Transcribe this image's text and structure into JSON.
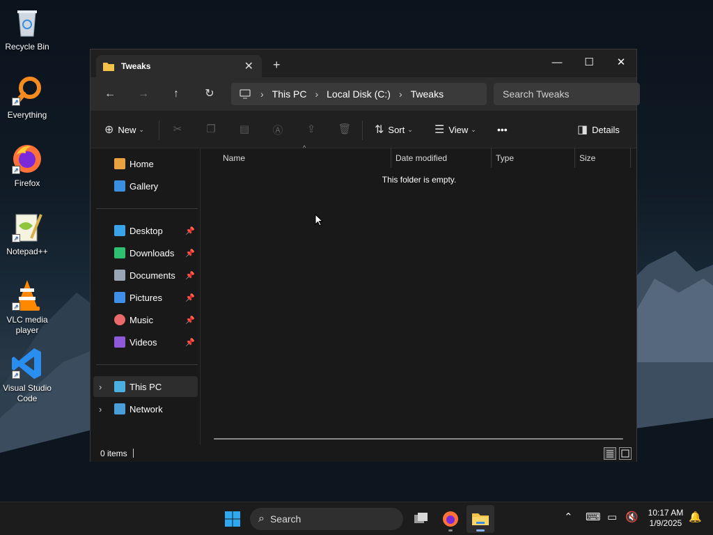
{
  "desktop": {
    "icons": [
      {
        "label": "Recycle Bin",
        "icon": "recycle-bin-icon"
      },
      {
        "label": "Everything",
        "icon": "everything-icon"
      },
      {
        "label": "Firefox",
        "icon": "firefox-icon"
      },
      {
        "label": "Notepad++",
        "icon": "notepad-plus-plus-icon"
      },
      {
        "label": "VLC media player",
        "icon": "vlc-icon"
      },
      {
        "label": "Visual Studio Code",
        "icon": "vscode-icon"
      }
    ]
  },
  "window": {
    "tab_title": "Tweaks",
    "tab_close": "✕",
    "new_tab": "+",
    "controls": {
      "minimize": "—",
      "maximize": "☐",
      "close": "✕"
    },
    "nav": {
      "back": "←",
      "forward": "→",
      "up": "↑",
      "refresh": "↻"
    },
    "breadcrumb": [
      "This PC",
      "Local Disk (C:)",
      "Tweaks"
    ],
    "search_placeholder": "Search Tweaks",
    "commands": {
      "new": "New",
      "sort": "Sort",
      "view": "View",
      "more": "•••",
      "details": "Details"
    },
    "sidebar": {
      "top": [
        {
          "label": "Home",
          "color": "#e8a040"
        },
        {
          "label": "Gallery",
          "color": "#3b8fe0"
        }
      ],
      "pinned": [
        {
          "label": "Desktop",
          "color": "#3ba3e8"
        },
        {
          "label": "Downloads",
          "color": "#2fbf71"
        },
        {
          "label": "Documents",
          "color": "#9aa6b6"
        },
        {
          "label": "Pictures",
          "color": "#3f8ee8"
        },
        {
          "label": "Music",
          "color": "#e86a6a"
        },
        {
          "label": "Videos",
          "color": "#8e5ad8"
        }
      ],
      "bottom": [
        {
          "label": "This PC",
          "color": "#4bb0e0"
        },
        {
          "label": "Network",
          "color": "#4a9ed8"
        }
      ]
    },
    "columns": [
      "Name",
      "Date modified",
      "Type",
      "Size"
    ],
    "empty_message": "This folder is empty.",
    "status": "0 items"
  },
  "taskbar": {
    "search_label": "Search",
    "time": "10:17 AM",
    "date": "1/9/2025"
  },
  "colors": {
    "window_bg": "#191919",
    "navbar_bg": "#2c2c2c",
    "accent": "#8ab4f8"
  }
}
